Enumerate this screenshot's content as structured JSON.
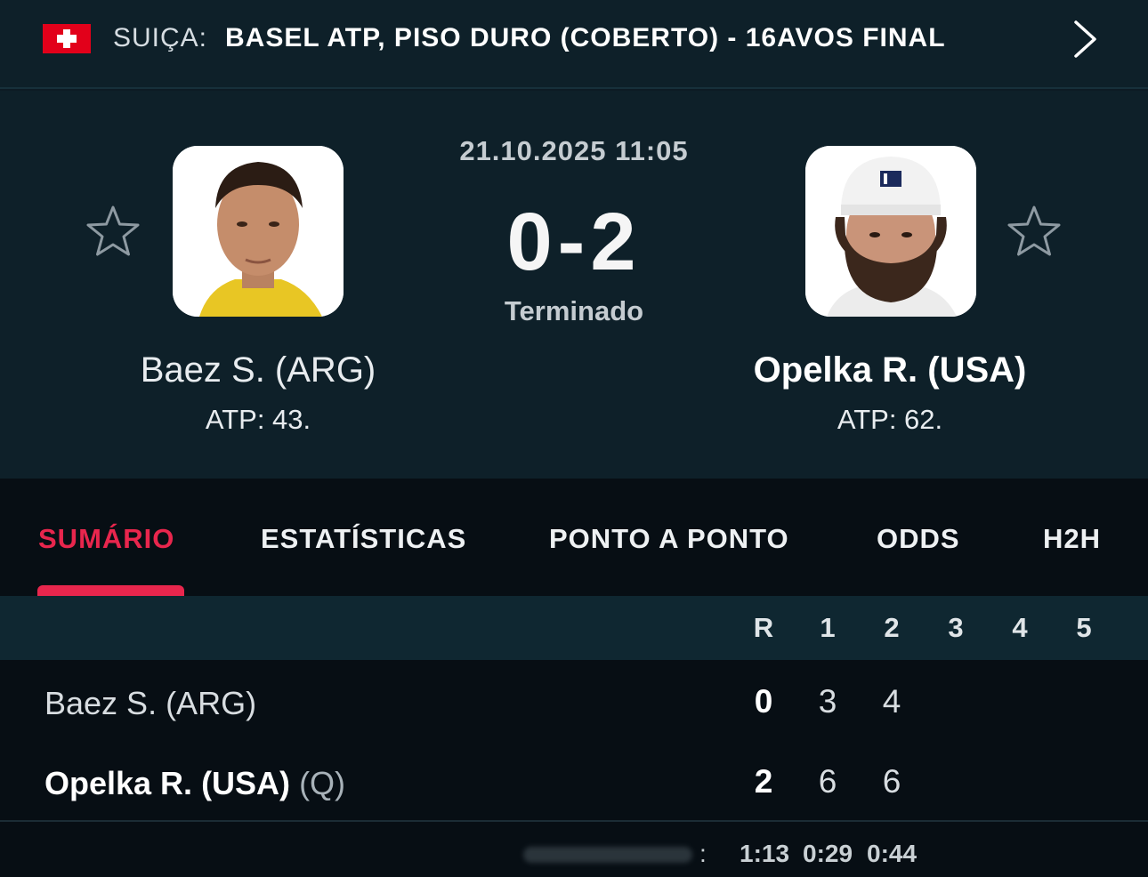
{
  "header": {
    "country": "SUIÇA:",
    "tournament": "BASEL ATP, PISO DURO (COBERTO) - 16AVOS FINAL",
    "flag_icon": "swiss-flag-icon",
    "next_icon": "chevron-right-icon"
  },
  "match": {
    "datetime": "21.10.2025 11:05",
    "score": "0-2",
    "status": "Terminado",
    "home": {
      "name": "Baez S. (ARG)",
      "rank": "ATP: 43."
    },
    "away": {
      "name": "Opelka R. (USA)",
      "rank": "ATP: 62."
    }
  },
  "tabs": [
    {
      "label": "SUMÁRIO",
      "active": true
    },
    {
      "label": "ESTATÍSTICAS",
      "active": false
    },
    {
      "label": "PONTO A PONTO",
      "active": false
    },
    {
      "label": "ODDS",
      "active": false
    },
    {
      "label": "H2H",
      "active": false
    }
  ],
  "table": {
    "headers": [
      "R",
      "1",
      "2",
      "3",
      "4",
      "5"
    ],
    "rows": [
      {
        "name": "Baez S. (ARG)",
        "qualifier": "",
        "total": "0",
        "sets": [
          "3",
          "4"
        ]
      },
      {
        "name": "Opelka R. (USA)",
        "qualifier": "(Q)",
        "total": "2",
        "sets": [
          "6",
          "6"
        ]
      }
    ],
    "duration_separator": ":",
    "durations": [
      "1:13",
      "0:29",
      "0:44"
    ]
  },
  "colors": {
    "accent": "#e8264d",
    "background": "#0e2029",
    "swiss_red": "#e2001a"
  }
}
